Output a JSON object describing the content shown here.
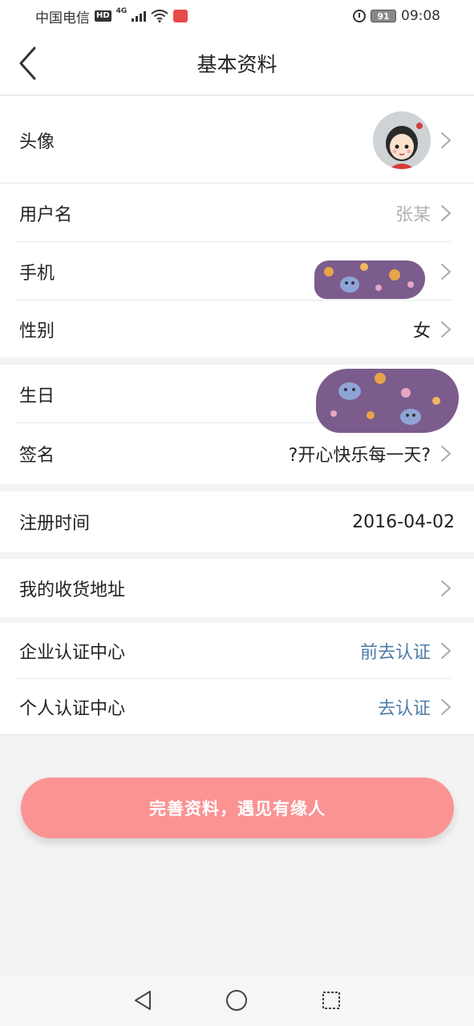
{
  "status_bar": {
    "carrier": "中国电信",
    "hd": "HD",
    "network": "4G",
    "battery": "91",
    "time": "09:08"
  },
  "nav": {
    "title": "基本资料",
    "back_icon": "chevron-left-icon"
  },
  "rows": {
    "avatar": {
      "label": "头像"
    },
    "username": {
      "label": "用户名",
      "value": "张某"
    },
    "phone": {
      "label": "手机",
      "value": ""
    },
    "gender": {
      "label": "性别",
      "value": "女"
    },
    "birthday": {
      "label": "生日",
      "value": ""
    },
    "signature": {
      "label": "签名",
      "value": "?开心快乐每一天?"
    },
    "register_time": {
      "label": "注册时间",
      "value": "2016-04-02"
    },
    "address": {
      "label": "我的收货地址"
    },
    "enterprise_cert": {
      "label": "企业认证中心",
      "value": "前去认证"
    },
    "personal_cert": {
      "label": "个人认证中心",
      "value": "去认证"
    }
  },
  "cta": {
    "label": "完善资料，遇见有缘人"
  },
  "colors": {
    "link": "#4e7ca6",
    "cta_bg": "#fb9393",
    "muted": "#b3b3b3",
    "background": "#f3f3f3"
  }
}
